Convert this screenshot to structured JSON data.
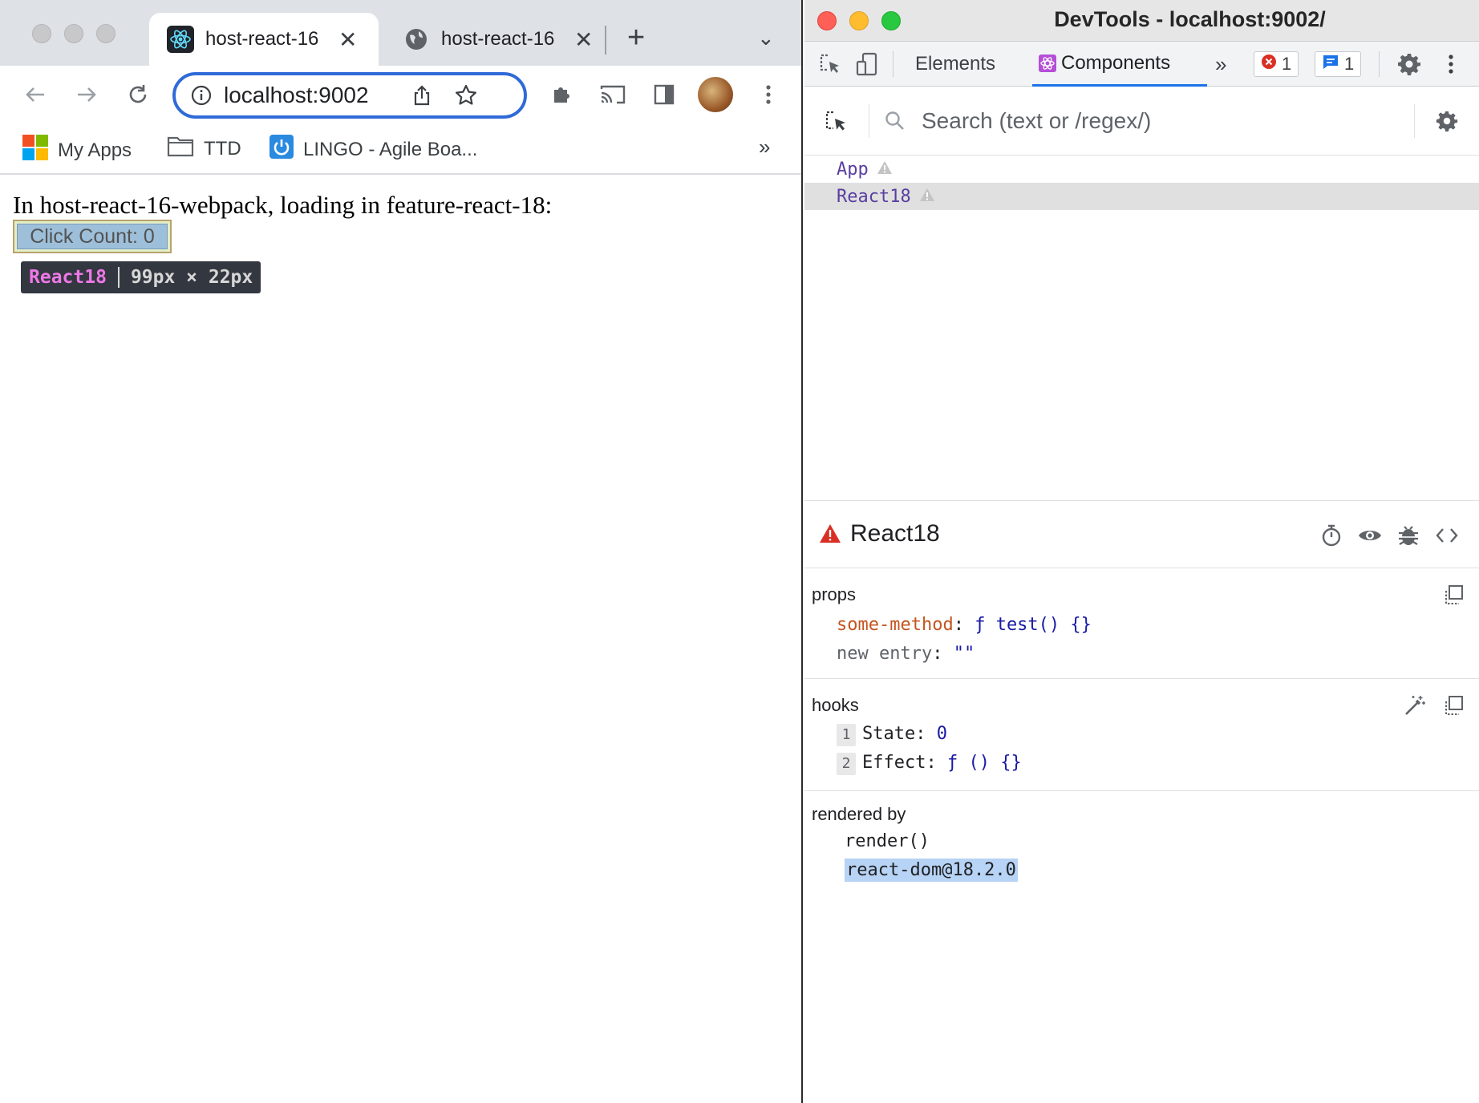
{
  "browser": {
    "tabs": [
      {
        "title": "host-react-16",
        "close": "✕",
        "icon": "react-icon"
      },
      {
        "title": "host-react-16",
        "close": "✕",
        "icon": "globe-icon"
      }
    ],
    "new_tab": "+",
    "tab_menu": "⌄",
    "address_bar": {
      "url": "localhost:9002"
    },
    "bookmarks": [
      {
        "label": "My Apps",
        "icon": "microsoft-apps-icon"
      },
      {
        "label": "TTD",
        "icon": "folder-icon"
      },
      {
        "label": "LINGO - Agile Boa...",
        "icon": "power-icon"
      }
    ],
    "bookmarks_more": "»",
    "page": {
      "text": "In host-react-16-webpack, loading in feature-react-18:",
      "button_label": "Click Count: 0",
      "highlight_tooltip": {
        "name": "React18",
        "dimensions": "99px × 22px"
      }
    }
  },
  "devtools": {
    "window_title": "DevTools - localhost:9002/",
    "tabs": [
      "Elements",
      "Components"
    ],
    "more_tabs": "»",
    "error_count": "1",
    "message_count": "1",
    "search_placeholder": "Search (text or /regex/)",
    "tree": [
      {
        "label": "App",
        "warning": true,
        "selected": false
      },
      {
        "label": "React18",
        "warning": true,
        "selected": true
      }
    ],
    "inspected": {
      "name": "React18",
      "props_title": "props",
      "props": [
        {
          "key": "some-method",
          "value": "ƒ test() {}"
        },
        {
          "key": "new entry",
          "value": "\"\""
        }
      ],
      "hooks_title": "hooks",
      "hooks": [
        {
          "index": "1",
          "name": "State",
          "value": "0"
        },
        {
          "index": "2",
          "name": "Effect",
          "value": "ƒ () {}"
        }
      ],
      "rendered_by_title": "rendered by",
      "rendered_by": [
        "render()",
        "react-dom@18.2.0"
      ]
    }
  },
  "colors": {
    "accent_blue": "#1a73e8",
    "component_purple": "#5a3ea1",
    "warning_red": "#d93025",
    "prop_orange": "#c5541f"
  }
}
